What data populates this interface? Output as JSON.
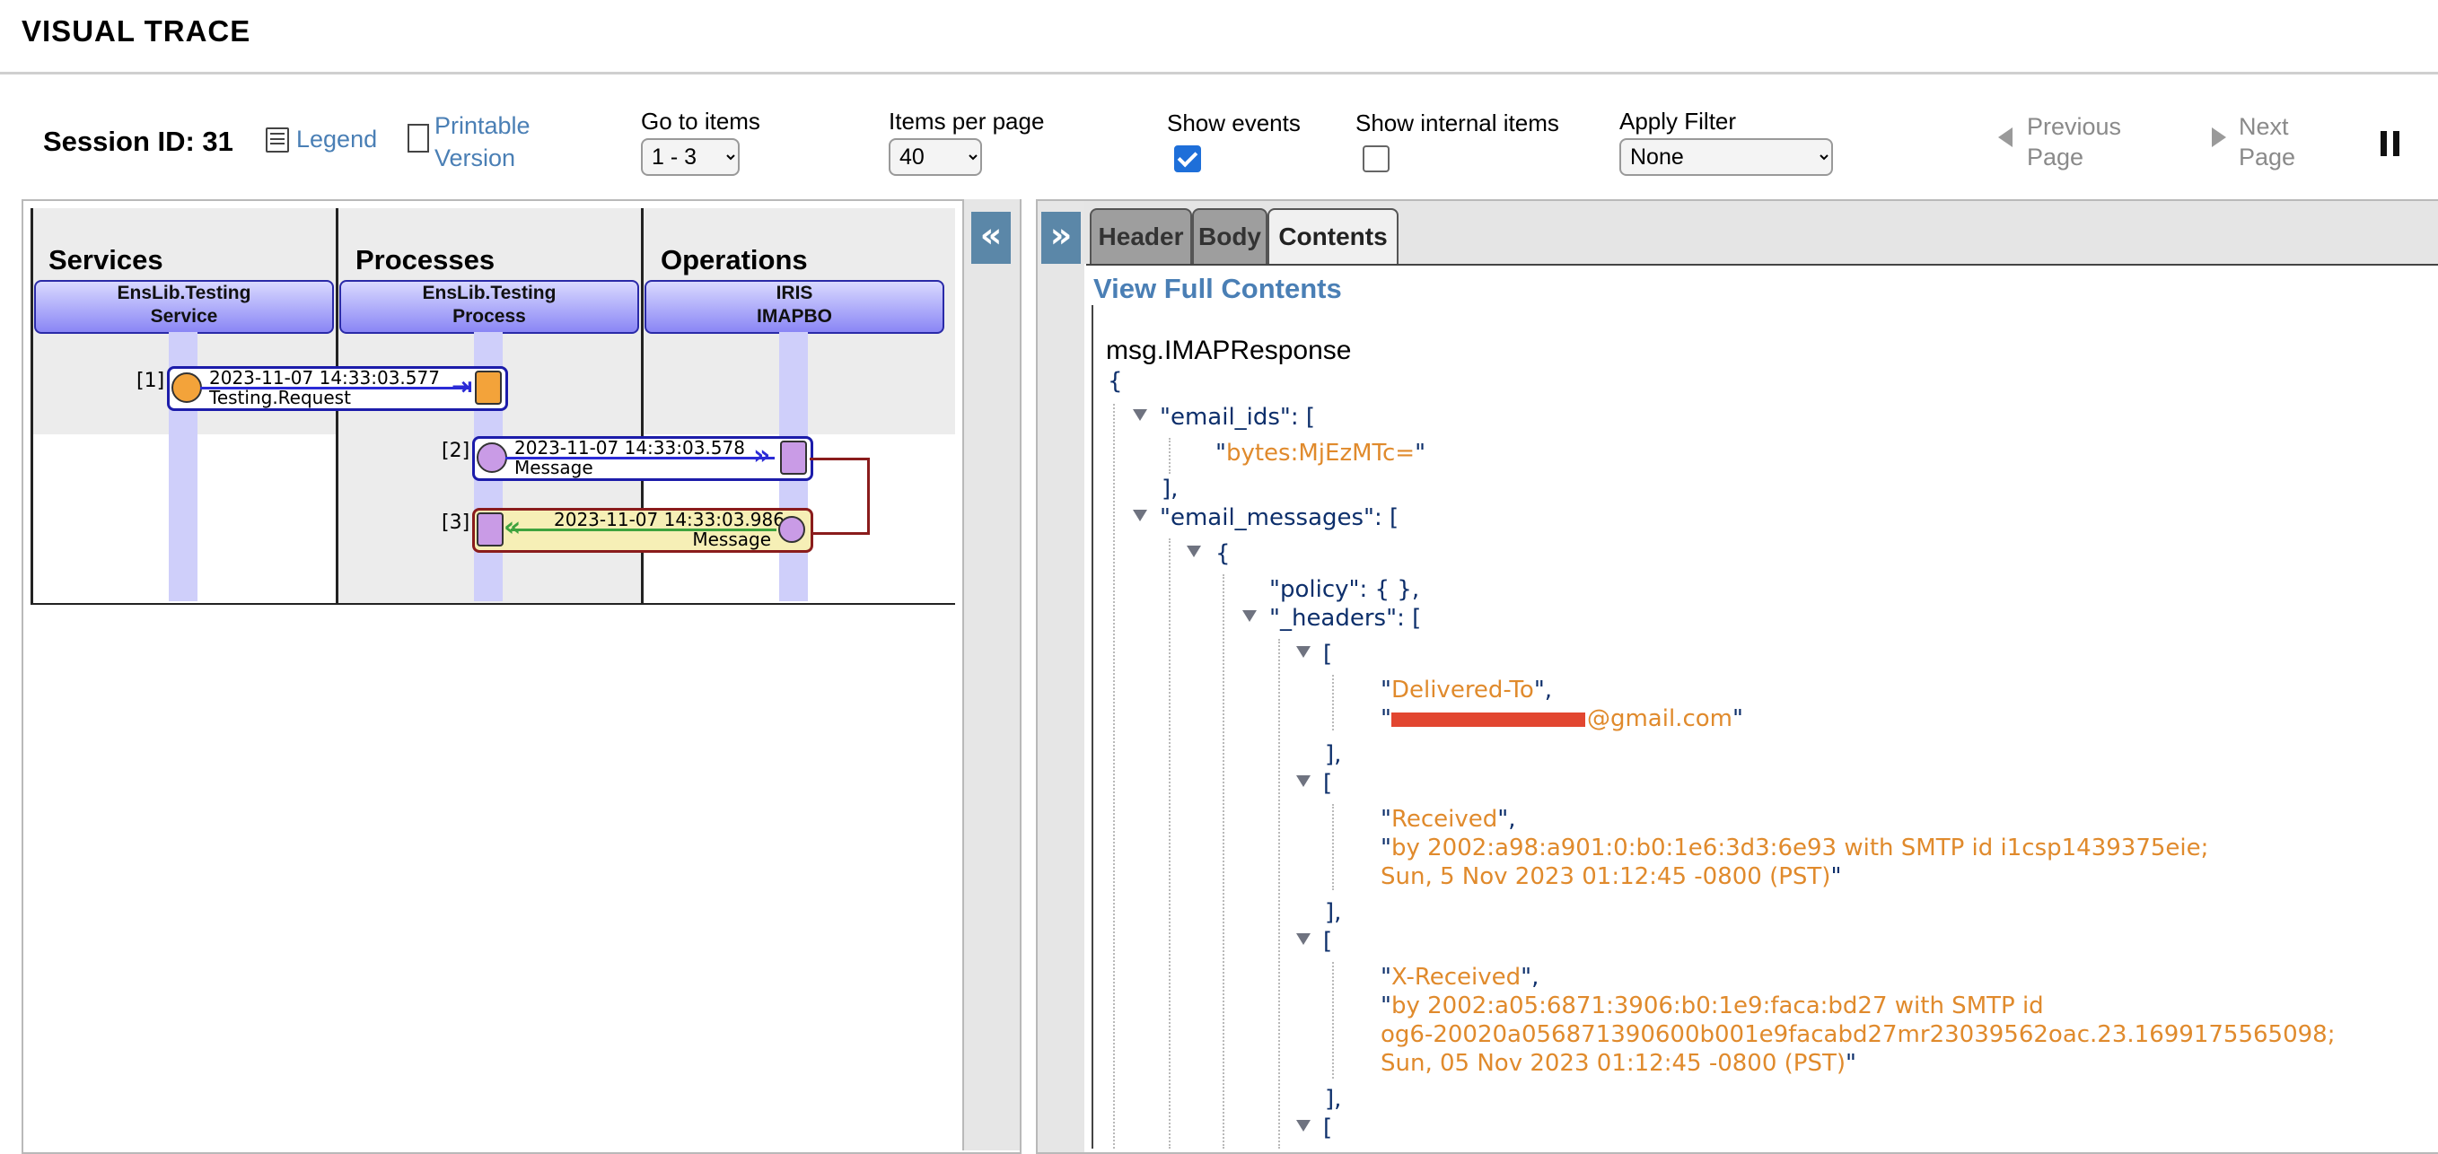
{
  "app": {
    "title": "VISUAL TRACE"
  },
  "toolbar": {
    "session": "Session ID: 31",
    "legend": "Legend",
    "printable_1": "Printable",
    "printable_2": "Version",
    "goto_label": "Go to items",
    "goto_value": "1 - 3",
    "perpage_label": "Items per page",
    "perpage_value": "40",
    "show_events_label": "Show events",
    "show_events_checked": true,
    "show_internal_label": "Show internal items",
    "show_internal_checked": false,
    "filter_label": "Apply Filter",
    "filter_value": "None",
    "prev_1": "Previous",
    "prev_2": "Page",
    "next_1": "Next",
    "next_2": "Page",
    "pause_icon": "pause-icon"
  },
  "diagram": {
    "columns": [
      "Services",
      "Processes",
      "Operations"
    ],
    "hosts": [
      {
        "line1": "EnsLib.Testing",
        "line2": "Service"
      },
      {
        "line1": "EnsLib.Testing",
        "line2": "Process"
      },
      {
        "line1": "IRIS",
        "line2": "IMAPBO"
      }
    ],
    "messages": [
      {
        "index": "[1]",
        "time": "2023-11-07 14:33:03.577",
        "name": "Testing.Request"
      },
      {
        "index": "[2]",
        "time": "2023-11-07 14:33:03.578",
        "name": "Message"
      },
      {
        "index": "[3]",
        "time": "2023-11-07 14:33:03.986",
        "name": "Message"
      }
    ],
    "colors": {
      "request_box": "#1c1caa",
      "response_box": "#8a1c1c",
      "response_fill": "#f6efb6",
      "service_node": "#f3a33a",
      "op_node": "#c99be6"
    }
  },
  "panel": {
    "collapse_left": "«",
    "collapse_right": "»",
    "tabs": [
      "Header",
      "Body",
      "Contents"
    ],
    "active_tab": "Contents",
    "view_full": "View Full Contents"
  },
  "contents": {
    "class_name": "msg.IMAPResponse",
    "open_brace": "{",
    "email_ids_key": "\"email_ids\"",
    "email_id_value": "bytes:MjEzMTc=",
    "email_messages_key": "\"email_messages\"",
    "policy_line": "\"policy\": { },",
    "headers_key": "\"_headers\"",
    "h1_name": "Delivered-To",
    "h1_value": "@gmail.com",
    "h2_name": "Received",
    "h2_value_1": "by 2002:a98:a901:0:b0:1e6:3d3:6e93 with SMTP id i1csp1439375eie;",
    "h2_value_2": "Sun, 5 Nov 2023 01:12:45 -0800 (PST)",
    "h3_name": "X-Received",
    "h3_value_1": "by 2002:a05:6871:3906:b0:1e9:faca:bd27 with SMTP id",
    "h3_value_2": "og6-20020a056871390600b001e9facabd27mr23039562oac.23.1699175565098;",
    "h3_value_3": "Sun, 05 Nov 2023 01:12:45 -0800 (PST)"
  }
}
